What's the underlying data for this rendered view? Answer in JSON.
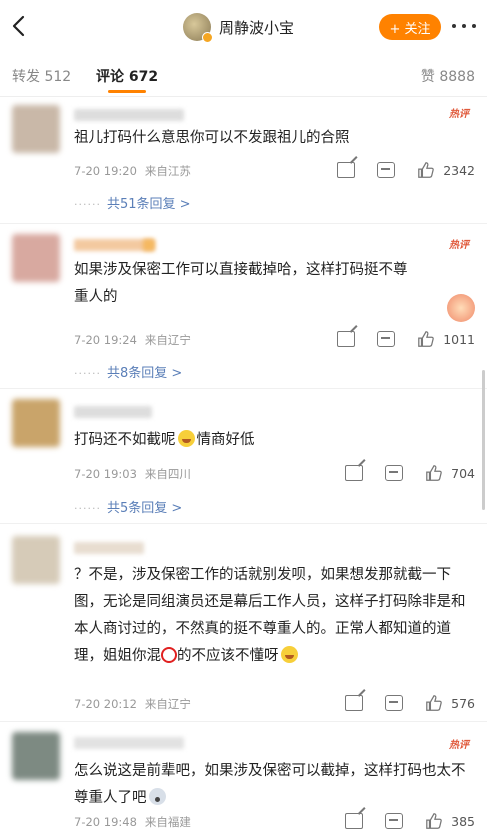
{
  "header": {
    "title": "周静波小宝",
    "follow_label": "+ 关注"
  },
  "tabs": {
    "repost": "转发 512",
    "comment": "评论 672",
    "like": "赞 8888"
  },
  "comments": [
    {
      "hot": "热评",
      "text": "祖儿打码什么意思你可以不发跟祖儿的合照",
      "time": "7-20 19:20",
      "location": "来自江苏",
      "likes": "2342",
      "replies": "共51条回复 >"
    },
    {
      "hot": "热评",
      "text": "如果涉及保密工作可以直接截掉哈，这样打码挺不尊重人的",
      "time": "7-20 19:24",
      "location": "来自辽宁",
      "likes": "1011",
      "replies": "共8条回复 >"
    },
    {
      "text_a": "打码还不如截呢",
      "text_b": "情商好低",
      "time": "7-20 19:03",
      "location": "来自四川",
      "likes": "704",
      "replies": "共5条回复 >"
    },
    {
      "text_a": "？不是，涉及保密工作的话就别发呗，如果想发那就截一下图，无论是同组演员还是幕后工作人员，这样子打码除非是和本人商讨过的，不然真的挺不尊重人的。正常人都知道的道理，姐姐你混",
      "text_b": "的不应该不懂呀",
      "time": "7-20 20:12",
      "location": "来自辽宁",
      "likes": "576"
    },
    {
      "hot": "热评",
      "text": "怎么说这是前辈吧，如果涉及保密可以截掉，这样打码也太不尊重人了吧",
      "time": "7-20 19:48",
      "location": "来自福建",
      "likes": "385"
    }
  ]
}
